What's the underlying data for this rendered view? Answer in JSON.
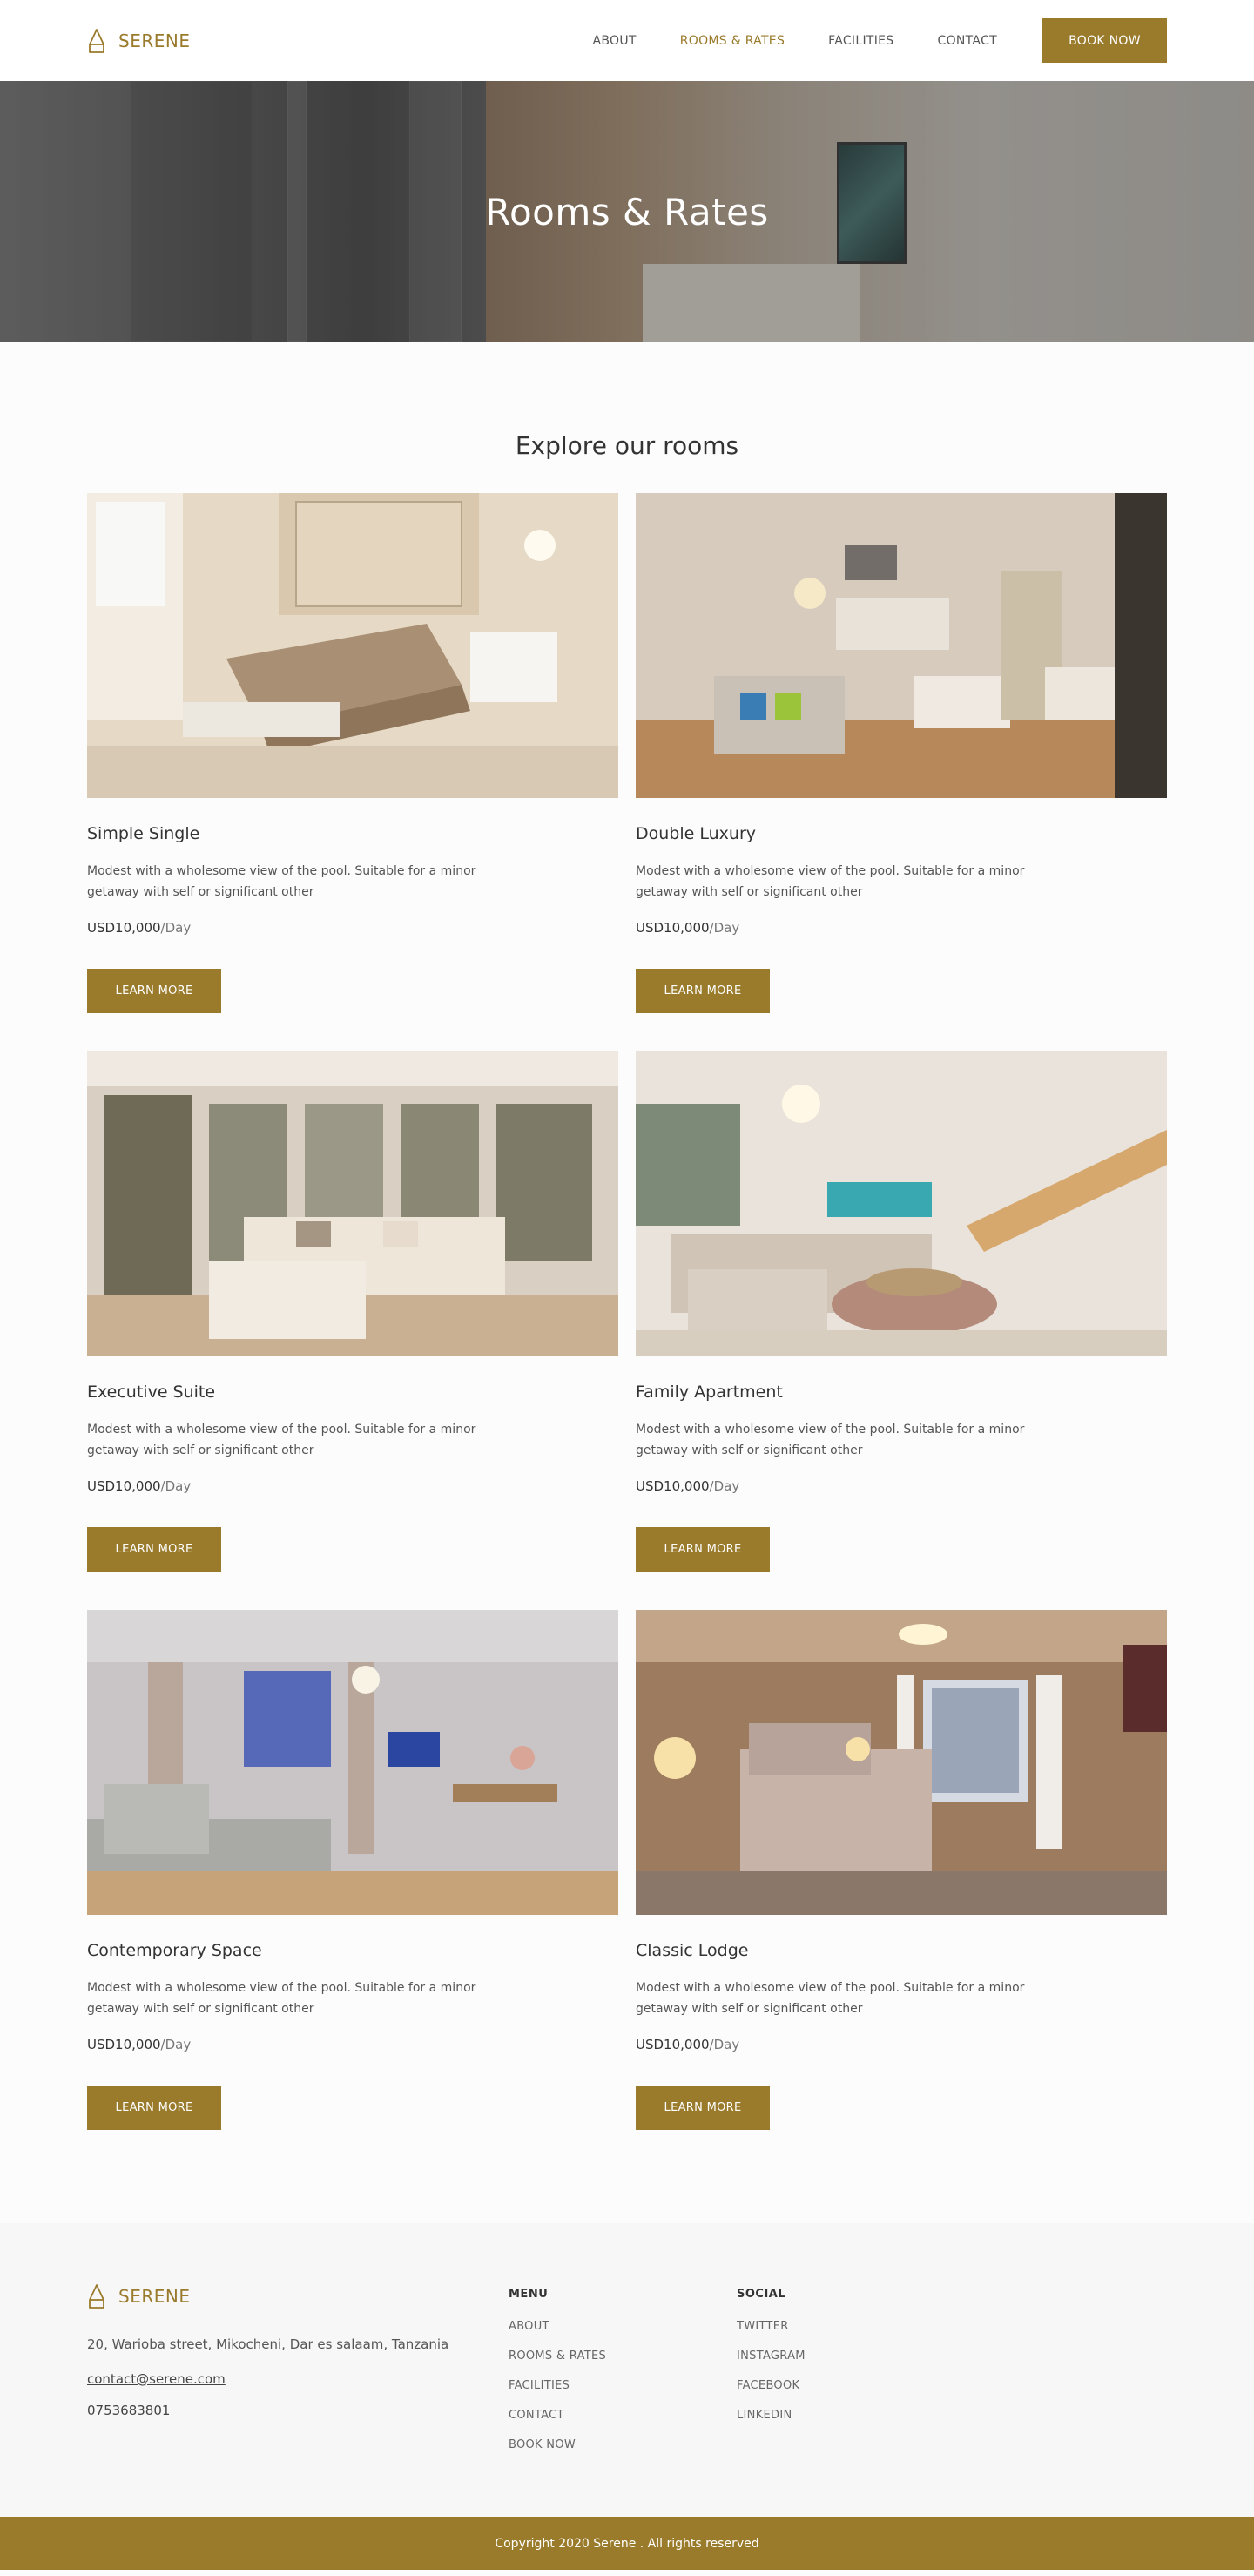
{
  "brand": {
    "name": "SERENE",
    "accent_color": "#9a7b2c",
    "logo_icon": "house-triangle-icon"
  },
  "nav": {
    "items": [
      {
        "label": "ABOUT",
        "active": false
      },
      {
        "label": "ROOMS & RATES",
        "active": true
      },
      {
        "label": "FACILITIES",
        "active": false
      },
      {
        "label": "CONTACT",
        "active": false
      }
    ],
    "book_now": "BOOK NOW"
  },
  "hero": {
    "title": "Rooms & Rates"
  },
  "rooms_section": {
    "title": "Explore our rooms",
    "rooms": [
      {
        "name": "Simple Single",
        "description": "Modest with a wholesome view of the pool. Suitable for a minor getaway with self or significant other",
        "price": "USD10,000",
        "unit": "/Day",
        "button": "LEARN MORE"
      },
      {
        "name": "Double Luxury",
        "description": "Modest with a wholesome view of the pool. Suitable for a minor getaway with self or significant other",
        "price": "USD10,000",
        "unit": "/Day",
        "button": "LEARN MORE"
      },
      {
        "name": "Executive Suite",
        "description": "Modest with a wholesome view of the pool. Suitable for a minor getaway with self or significant other",
        "price": "USD10,000",
        "unit": "/Day",
        "button": "LEARN MORE"
      },
      {
        "name": "Family Apartment",
        "description": "Modest with a wholesome view of the pool. Suitable for a minor getaway with self or significant other",
        "price": "USD10,000",
        "unit": "/Day",
        "button": "LEARN MORE"
      },
      {
        "name": "Contemporary Space",
        "description": "Modest with a wholesome view of the pool. Suitable for a minor getaway with self or significant other",
        "price": "USD10,000",
        "unit": "/Day",
        "button": "LEARN MORE"
      },
      {
        "name": "Classic Lodge",
        "description": "Modest with a wholesome view of the pool. Suitable for a minor getaway with self or significant other",
        "price": "USD10,000",
        "unit": "/Day",
        "button": "LEARN MORE"
      }
    ]
  },
  "footer": {
    "brand_name": "SERENE",
    "address": "20, Warioba street, Mikocheni, Dar es salaam, Tanzania",
    "email": "contact@serene.com",
    "phone": "0753683801",
    "menu": {
      "title": "MENU",
      "links": [
        "ABOUT",
        "ROOMS & RATES",
        "FACILITIES",
        "CONTACT",
        "BOOK NOW"
      ]
    },
    "social": {
      "title": "SOCIAL",
      "links": [
        "TWITTER",
        "INSTAGRAM",
        "FACEBOOK",
        "LINKEDIN"
      ]
    },
    "copyright": "Copyright 2020 Serene . All rights reserved"
  }
}
